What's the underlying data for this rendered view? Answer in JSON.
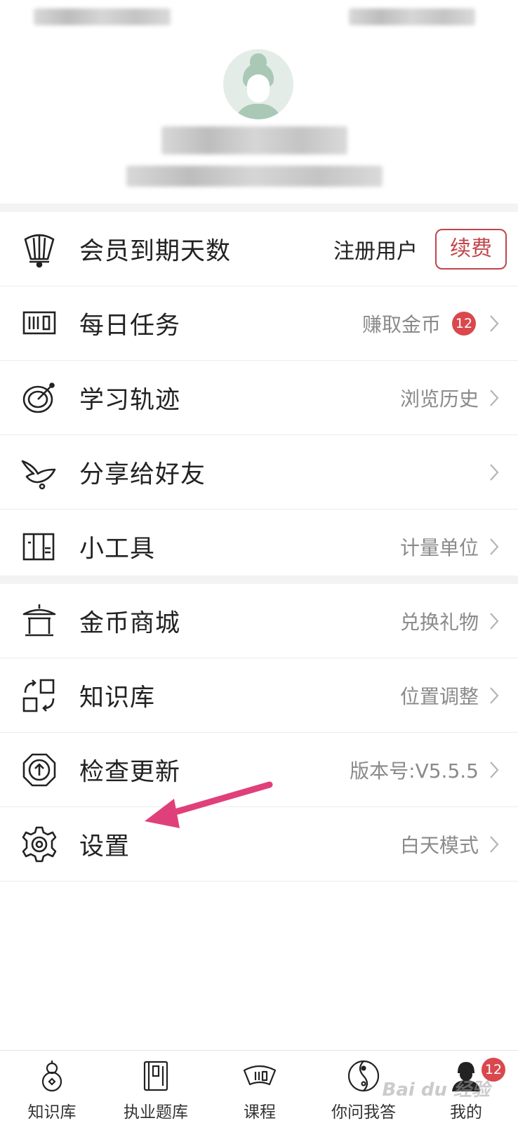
{
  "menu_group_1": [
    {
      "key": "membership",
      "label": "会员到期天数",
      "status": "注册用户",
      "button": "续费",
      "icon": "fan-icon"
    },
    {
      "key": "daily_tasks",
      "label": "每日任务",
      "value": "赚取金币",
      "badge": "12",
      "icon": "abacus-icon"
    },
    {
      "key": "study_track",
      "label": "学习轨迹",
      "value": "浏览历史",
      "icon": "compass-icon"
    },
    {
      "key": "share",
      "label": "分享给好友",
      "value": "",
      "icon": "dove-icon"
    },
    {
      "key": "tools",
      "label": "小工具",
      "value": "计量单位",
      "icon": "ruler-box-icon"
    }
  ],
  "menu_group_2": [
    {
      "key": "coin_mall",
      "label": "金币商城",
      "value": "兑换礼物",
      "icon": "pavilion-icon"
    },
    {
      "key": "knowledge_base",
      "label": "知识库",
      "value": "位置调整",
      "icon": "reorder-icon"
    },
    {
      "key": "check_update",
      "label": "检查更新",
      "value": "版本号:V5.5.5",
      "icon": "upload-octagon-icon"
    },
    {
      "key": "settings",
      "label": "设置",
      "value": "白天模式",
      "icon": "gear-icon"
    }
  ],
  "bottom_nav": [
    {
      "key": "knowledge",
      "label": "知识库",
      "icon": "gourd-icon"
    },
    {
      "key": "question_bank",
      "label": "执业题库",
      "icon": "book-icon"
    },
    {
      "key": "courses",
      "label": "课程",
      "icon": "fan-icon"
    },
    {
      "key": "qa",
      "label": "你问我答",
      "icon": "yin-yang-icon"
    },
    {
      "key": "mine",
      "label": "我的",
      "icon": "person-icon",
      "badge": "12",
      "active": true
    }
  ],
  "watermark": "Bai du 经验",
  "colors": {
    "accent_red": "#c0464a",
    "badge_red": "#d9484d",
    "annotation_pink": "#e0407a",
    "secondary_text": "#8a8a8a"
  }
}
